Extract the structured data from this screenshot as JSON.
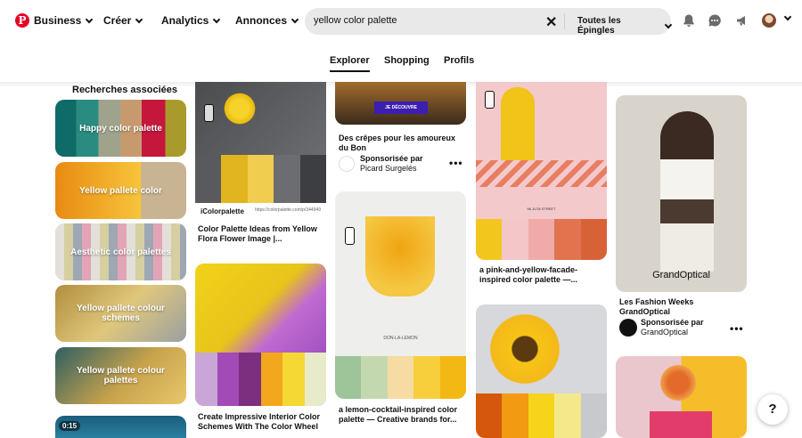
{
  "header": {
    "logo": "P",
    "nav": [
      {
        "label": "Business"
      },
      {
        "label": "Créer"
      },
      {
        "label": "Analytics"
      },
      {
        "label": "Annonces"
      }
    ],
    "search_value": "yellow color palette",
    "search_scope": "Toutes les Épingles",
    "icons": [
      "bell-icon",
      "chat-icon",
      "megaphone-icon",
      "avatar",
      "chevron-down-icon"
    ]
  },
  "tabs": [
    {
      "label": "Explorer",
      "active": true
    },
    {
      "label": "Shopping"
    },
    {
      "label": "Profils"
    }
  ],
  "related": {
    "title": "Recherches associées",
    "items": [
      {
        "label": "Happy color palette"
      },
      {
        "label": "Yellow pallete color"
      },
      {
        "label": "Aesthetic color palettes"
      },
      {
        "label": "Yellow pallete colour schemes"
      },
      {
        "label": "Yellow pallete colour palettes"
      }
    ],
    "video_duration": "0:15"
  },
  "pins": {
    "p1": {
      "title": "Color Palette Ideas from Yellow Flora Flower Image |...",
      "brand": "iColorpalette",
      "url": "https://colorpalette.com/p/344949"
    },
    "p2": {
      "title": "Create Impressive Interior Color Schemes With The Color Wheel"
    },
    "p3": {
      "title": "Des crêpes pour les amoureux du Bon",
      "cta": "JE DÉCOUVRE",
      "sponsored": "Sponsorisée par",
      "advertiser": "Picard Surgelés"
    },
    "p4": {
      "title": "a lemon-cocktail-inspired color palette — Creative brands for...",
      "caption": "DON-LA-LEMON"
    },
    "p5": {
      "title": "a pink-and-yellow-facade-inspired color palette —...",
      "caption": "96 JUTA STREET"
    },
    "p6": {},
    "p7": {
      "title": "Les Fashion Weeks GrandOptical",
      "logo": "GrandOptical",
      "sponsored": "Sponsorisée par",
      "advertiser": "GrandOptical"
    }
  },
  "help_label": "?",
  "colors": {
    "brand": "#e60023",
    "accent": "#f5d000"
  }
}
